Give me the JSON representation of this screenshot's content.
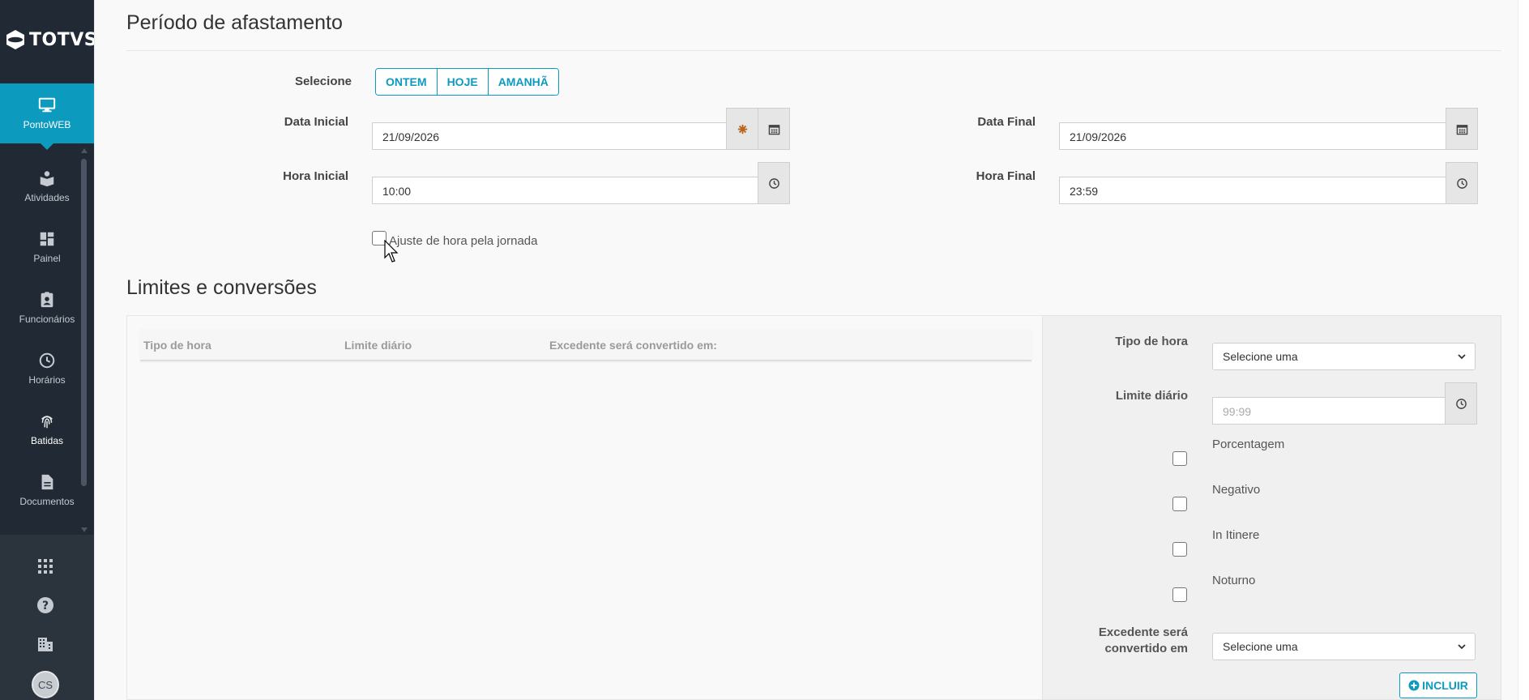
{
  "app": {
    "brand": "TOTVS",
    "accent_color": "#0c9abe"
  },
  "sidebar": {
    "items": [
      {
        "label": "PontoWEB",
        "icon": "monitor-icon",
        "active": true
      },
      {
        "label": "Atividades",
        "icon": "activities-icon",
        "active": false
      },
      {
        "label": "Painel",
        "icon": "dashboard-icon",
        "active": false
      },
      {
        "label": "Funcionários",
        "icon": "badge-icon",
        "active": false
      },
      {
        "label": "Horários",
        "icon": "clock-icon",
        "active": false
      },
      {
        "label": "Batidas",
        "icon": "fingerprint-icon",
        "active": false
      },
      {
        "label": "Documentos",
        "icon": "document-icon",
        "active": false
      }
    ],
    "bottom_icons": [
      "apps-grid-icon",
      "help-icon",
      "building-icon"
    ],
    "avatar_initials": "CS"
  },
  "periodo": {
    "title": "Período de afastamento",
    "select_label": "Selecione",
    "quick_buttons": [
      "ONTEM",
      "HOJE",
      "AMANHÃ"
    ],
    "data_inicial_label": "Data Inicial",
    "data_inicial_value": "21/09/2026",
    "data_final_label": "Data Final",
    "data_final_value": "21/09/2026",
    "hora_inicial_label": "Hora Inicial",
    "hora_inicial_value": "10:00",
    "hora_final_label": "Hora Final",
    "hora_final_value": "23:59",
    "ajuste_label": "Ajuste de hora pela jornada"
  },
  "limites": {
    "title": "Limites e conversões",
    "table_headers": [
      "Tipo de hora",
      "Limite diário",
      "Excedente será convertido em:"
    ],
    "form": {
      "tipo_hora_label": "Tipo de hora",
      "tipo_hora_value": "Selecione uma",
      "limite_label": "Limite diário",
      "limite_placeholder": "99:99",
      "checkboxes": [
        "Porcentagem",
        "Negativo",
        "In Itinere",
        "Noturno"
      ],
      "excedente_label_line1": "Excedente será",
      "excedente_label_line2": "convertido em",
      "excedente_value": "Selecione uma",
      "incluir_label": "INCLUIR"
    }
  }
}
